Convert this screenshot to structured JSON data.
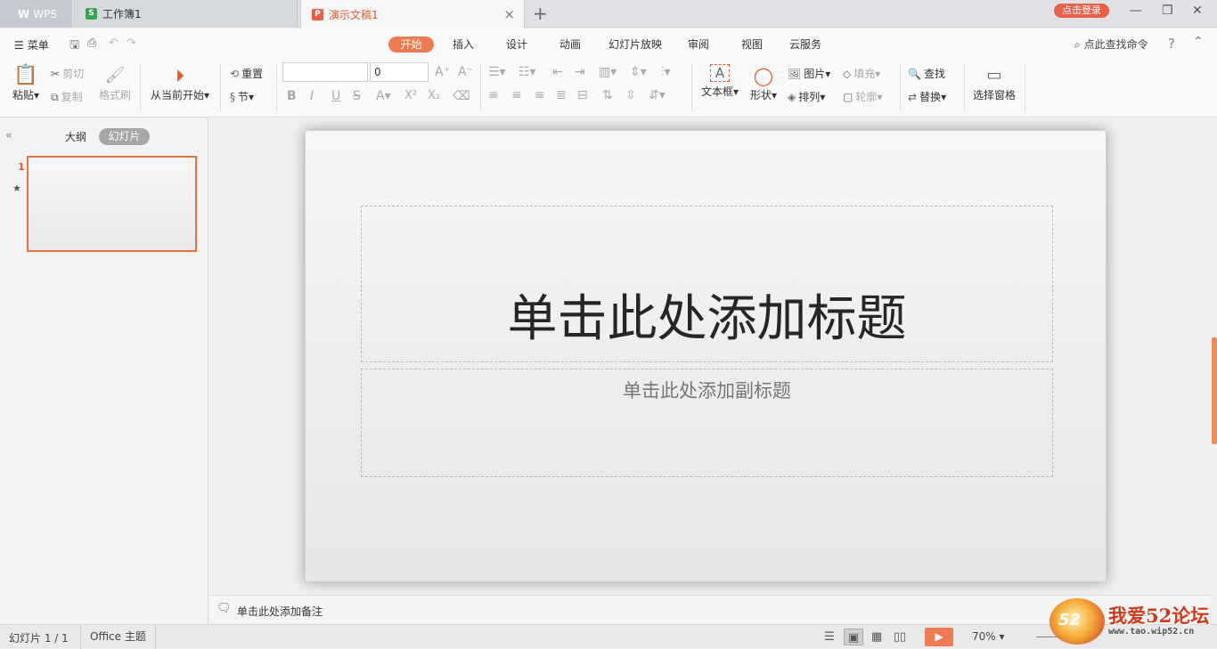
{
  "tabs": {
    "wps_label": "WPS",
    "workbook_label": "工作簿1",
    "workbook_icon": "S",
    "doc_label": "演示文稿1",
    "doc_icon": "P",
    "close_glyph": "×",
    "add_glyph": "+"
  },
  "window": {
    "login_label": "点击登录",
    "minimize": "—",
    "restore": "❐",
    "close": "✕"
  },
  "ribbon": {
    "menu_label": "菜单",
    "tabs": [
      "开始",
      "插入",
      "设计",
      "动画",
      "幻灯片放映",
      "审阅",
      "视图",
      "云服务"
    ],
    "search_placeholder": "点此查找命令",
    "paste": "粘贴",
    "cut": "剪切",
    "copy": "复制",
    "format_painter": "格式刷",
    "from_current": "从当前开始",
    "reset": "重置",
    "section": "节",
    "font_size": "0",
    "font_name": "",
    "text_box": "文本框",
    "shape": "形状",
    "picture": "图片",
    "arrange": "排列",
    "fill": "填充",
    "outline": "轮廓",
    "find": "查找",
    "replace": "替换",
    "selection_pane": "选择窗格"
  },
  "panel": {
    "outline_tab": "大纲",
    "slides_tab": "幻灯片",
    "slide_number": "1"
  },
  "slide": {
    "title_placeholder": "单击此处添加标题",
    "subtitle_placeholder": "单击此处添加副标题"
  },
  "notes": {
    "placeholder": "单击此处添加备注"
  },
  "status": {
    "slide_count": "幻灯片 1 / 1",
    "theme": "Office 主题",
    "zoom": "70%"
  },
  "watermark": {
    "logo_text": "52",
    "title": "我爱52论坛",
    "url": "www.tao.wip52.cn"
  },
  "colors": {
    "accent": "#f07b52",
    "selected_border": "#e0733f"
  }
}
